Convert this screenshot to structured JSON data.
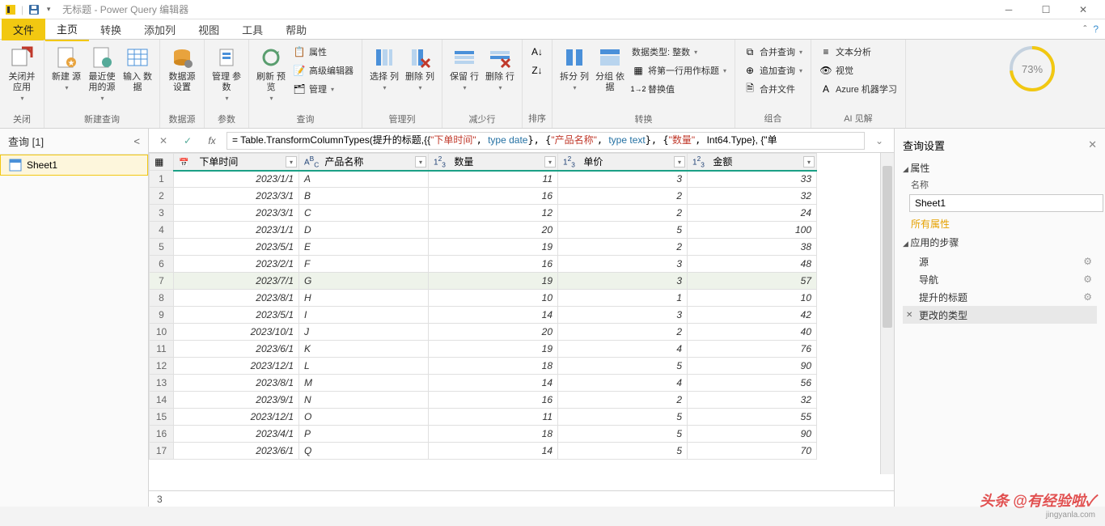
{
  "window": {
    "title": "无标题 - Power Query 编辑器"
  },
  "tabs": {
    "file": "文件",
    "home": "主页",
    "transform": "转换",
    "addcol": "添加列",
    "view": "视图",
    "tool": "工具",
    "help": "帮助"
  },
  "ribbon": {
    "close": {
      "label": "关闭并\n应用",
      "group": "关闭"
    },
    "newquery": {
      "newsource": "新建\n源",
      "recent": "最近使\n用的源",
      "input": "输入\n数据",
      "group": "新建查询"
    },
    "datasource": {
      "settings": "数据源\n设置",
      "group": "数据源"
    },
    "params": {
      "manage": "管理\n参数",
      "group": "参数"
    },
    "query": {
      "refresh": "刷新\n预览",
      "props": "属性",
      "adv": "高级编辑器",
      "manage": "管理",
      "group": "查询"
    },
    "cols": {
      "choose": "选择\n列",
      "remove": "删除\n列",
      "group": "管理列"
    },
    "rows": {
      "keep": "保留\n行",
      "remove": "删除\n行",
      "group": "减少行"
    },
    "sort": {
      "group": "排序"
    },
    "transform": {
      "split": "拆分\n列",
      "groupby": "分组\n依据",
      "dtype": "数据类型: 整数",
      "firstrow": "将第一行用作标题",
      "replace": "替换值",
      "group": "转换"
    },
    "combine": {
      "merge": "合并查询",
      "append": "追加查询",
      "mergefile": "合并文件",
      "group": "组合"
    },
    "ai": {
      "text": "文本分析",
      "vision": "视觉",
      "azure": "Azure 机器学习",
      "group": "AI 见解"
    },
    "progress": "73%"
  },
  "left": {
    "title": "查询 [1]",
    "items": [
      "Sheet1"
    ]
  },
  "formula": {
    "prefix": "= Table.TransformColumnTypes(提升的标题,{{",
    "p1": "\"下单时间\"",
    "t1": "type date",
    "p2": "\"产品名称\"",
    "t2": "type text",
    "p3": "\"数量\"",
    "t3": "Int64.Type",
    "suffix": "}, {\"单"
  },
  "columns": [
    {
      "name": "下单时间",
      "type": "date"
    },
    {
      "name": "产品名称",
      "type": "ABC"
    },
    {
      "name": "数量",
      "type": "123"
    },
    {
      "name": "单价",
      "type": "123"
    },
    {
      "name": "金额",
      "type": "123"
    }
  ],
  "rows": [
    {
      "n": 1,
      "date": "2023/1/1",
      "prod": "A",
      "qty": 11,
      "price": 3,
      "amt": 33
    },
    {
      "n": 2,
      "date": "2023/3/1",
      "prod": "B",
      "qty": 16,
      "price": 2,
      "amt": 32
    },
    {
      "n": 3,
      "date": "2023/3/1",
      "prod": "C",
      "qty": 12,
      "price": 2,
      "amt": 24
    },
    {
      "n": 4,
      "date": "2023/1/1",
      "prod": "D",
      "qty": 20,
      "price": 5,
      "amt": 100
    },
    {
      "n": 5,
      "date": "2023/5/1",
      "prod": "E",
      "qty": 19,
      "price": 2,
      "amt": 38
    },
    {
      "n": 6,
      "date": "2023/2/1",
      "prod": "F",
      "qty": 16,
      "price": 3,
      "amt": 48
    },
    {
      "n": 7,
      "date": "2023/7/1",
      "prod": "G",
      "qty": 19,
      "price": 3,
      "amt": 57
    },
    {
      "n": 8,
      "date": "2023/8/1",
      "prod": "H",
      "qty": 10,
      "price": 1,
      "amt": 10
    },
    {
      "n": 9,
      "date": "2023/5/1",
      "prod": "I",
      "qty": 14,
      "price": 3,
      "amt": 42
    },
    {
      "n": 10,
      "date": "2023/10/1",
      "prod": "J",
      "qty": 20,
      "price": 2,
      "amt": 40
    },
    {
      "n": 11,
      "date": "2023/6/1",
      "prod": "K",
      "qty": 19,
      "price": 4,
      "amt": 76
    },
    {
      "n": 12,
      "date": "2023/12/1",
      "prod": "L",
      "qty": 18,
      "price": 5,
      "amt": 90
    },
    {
      "n": 13,
      "date": "2023/8/1",
      "prod": "M",
      "qty": 14,
      "price": 4,
      "amt": 56
    },
    {
      "n": 14,
      "date": "2023/9/1",
      "prod": "N",
      "qty": 16,
      "price": 2,
      "amt": 32
    },
    {
      "n": 15,
      "date": "2023/12/1",
      "prod": "O",
      "qty": 11,
      "price": 5,
      "amt": 55
    },
    {
      "n": 16,
      "date": "2023/4/1",
      "prod": "P",
      "qty": 18,
      "price": 5,
      "amt": 90
    },
    {
      "n": 17,
      "date": "2023/6/1",
      "prod": "Q",
      "qty": 14,
      "price": 5,
      "amt": 70
    }
  ],
  "status": "3",
  "right": {
    "title": "查询设置",
    "props": "属性",
    "name_label": "名称",
    "name_value": "Sheet1",
    "allprops": "所有属性",
    "steps_title": "应用的步骤",
    "steps": [
      "源",
      "导航",
      "提升的标题",
      "更改的类型"
    ],
    "selected_step": 3
  },
  "watermark": {
    "main": "头条 @有经验啦✓",
    "sub": "jingyanla.com"
  }
}
